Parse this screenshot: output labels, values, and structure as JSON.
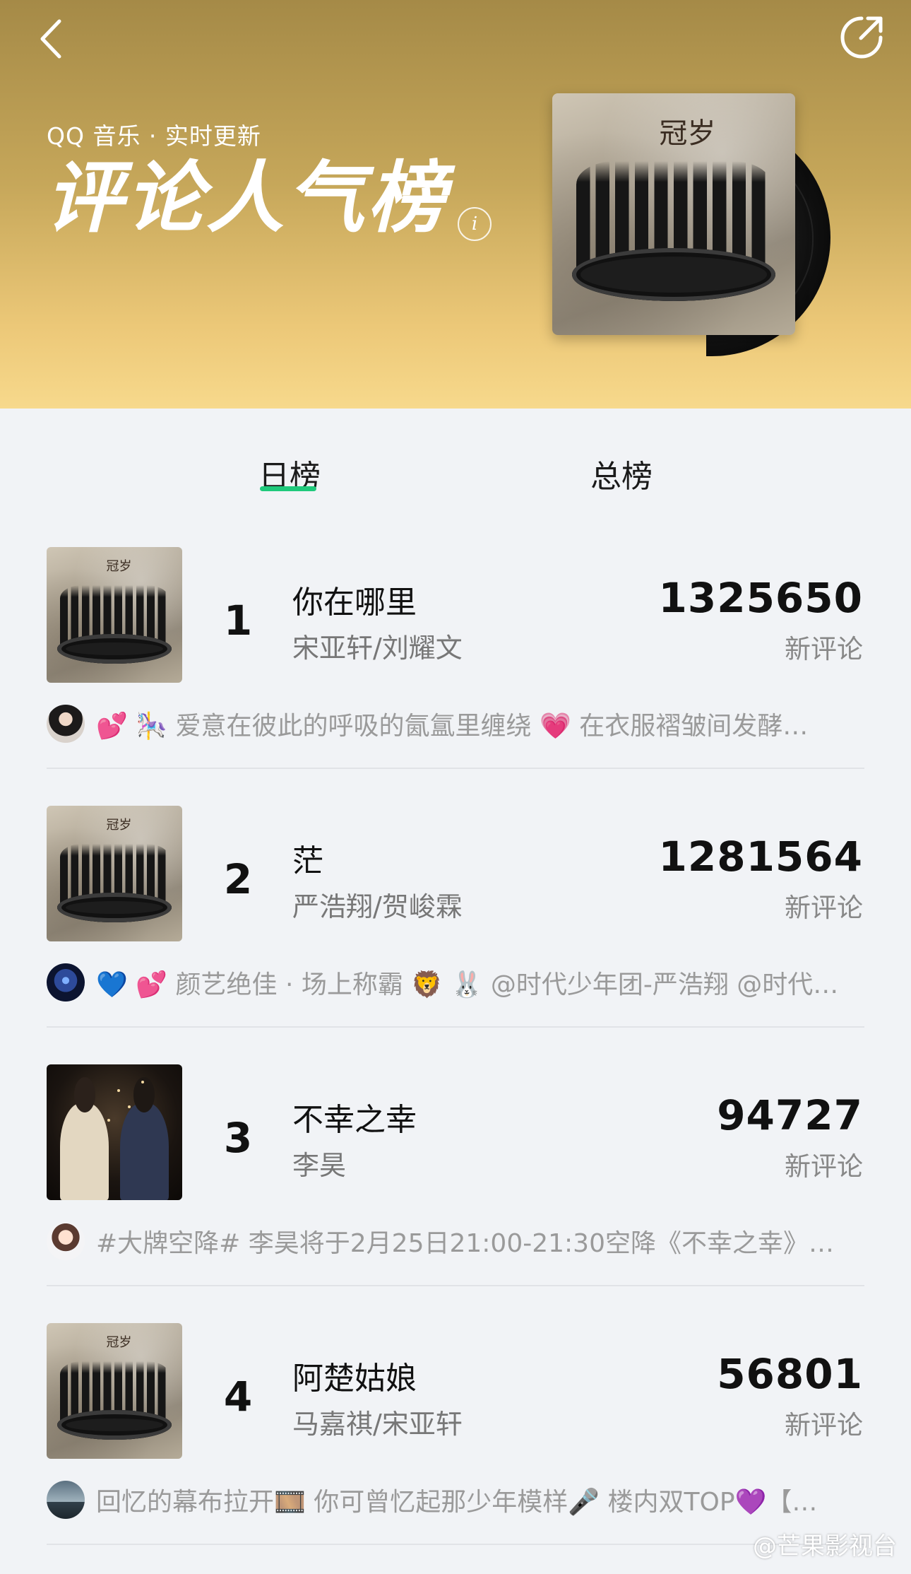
{
  "header": {
    "subtitle": "QQ 音乐 · 实时更新",
    "title": "评论人气榜",
    "icons": {
      "back": "back-arrow-icon",
      "share": "share-icon",
      "info": "info-icon"
    },
    "info_glyph": "i",
    "cover_mark": "冠岁"
  },
  "tabs": {
    "daily": "日榜",
    "total": "总榜",
    "active": "日榜",
    "accent": "#1fc97b"
  },
  "items": [
    {
      "rank": "1",
      "song": "你在哪里",
      "artist": "宋亚轩/刘耀文",
      "count": "1325650",
      "count_label": "新评论",
      "comment": "💕 🎠 爱意在彼此的呼吸的氤氲里缠绕 💗 在衣服褶皱间发酵…",
      "cover_mark": "冠岁"
    },
    {
      "rank": "2",
      "song": "茫",
      "artist": "严浩翔/贺峻霖",
      "count": "1281564",
      "count_label": "新评论",
      "comment": "💙 💕 颜艺绝佳 · 场上称霸 🦁 🐰 @时代少年团-严浩翔 @时代…",
      "cover_mark": "冠岁"
    },
    {
      "rank": "3",
      "song": "不幸之幸",
      "artist": "李昊",
      "count": "94727",
      "count_label": "新评论",
      "comment": "#大牌空降# 李昊将于2月25日21:00-21:30空降《不幸之幸》…"
    },
    {
      "rank": "4",
      "song": "阿楚姑娘",
      "artist": "马嘉祺/宋亚轩",
      "count": "56801",
      "count_label": "新评论",
      "comment": "回忆的幕布拉开🎞️ 你可曾忆起那少年模样🎤 楼内双TOP💜【…",
      "cover_mark": "冠岁"
    }
  ],
  "watermark": "@芒果影视台"
}
